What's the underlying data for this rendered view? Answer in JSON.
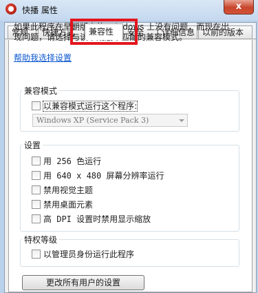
{
  "window": {
    "title": "快播 属性",
    "close_label": "x"
  },
  "tabs": [
    {
      "label": "常规"
    },
    {
      "label": "快捷方式"
    },
    {
      "label": "兼容性"
    },
    {
      "label": "安全"
    },
    {
      "label": "详细信息"
    },
    {
      "label": "以前的版本"
    }
  ],
  "intro": {
    "text": "如果此程序在早期版本的 Windows 上没有问题，而现在出现问题，请选择与该早期版本匹配的兼容模式。",
    "help_link": "帮助我选择设置"
  },
  "compat_mode": {
    "title": "兼容模式",
    "checkbox_label": "以兼容模式运行这个程序:",
    "checked": false,
    "select_value": "Windows XP (Service Pack 3)"
  },
  "settings": {
    "title": "设置",
    "options": [
      {
        "label": "用 256 色运行",
        "checked": false
      },
      {
        "label": "用 640 x 480 屏幕分辨率运行",
        "checked": false
      },
      {
        "label": "禁用视觉主题",
        "checked": false
      },
      {
        "label": "禁用桌面元素",
        "checked": false
      },
      {
        "label": "高 DPI 设置时禁用显示缩放",
        "checked": false
      }
    ]
  },
  "privilege": {
    "title": "特权等级",
    "checkbox_label": "以管理员身份运行此程序",
    "checked": false
  },
  "buttons": {
    "change_all_users": "更改所有用户的设置"
  },
  "colors": {
    "highlight": "#e3151d",
    "link": "#0b57d0"
  }
}
